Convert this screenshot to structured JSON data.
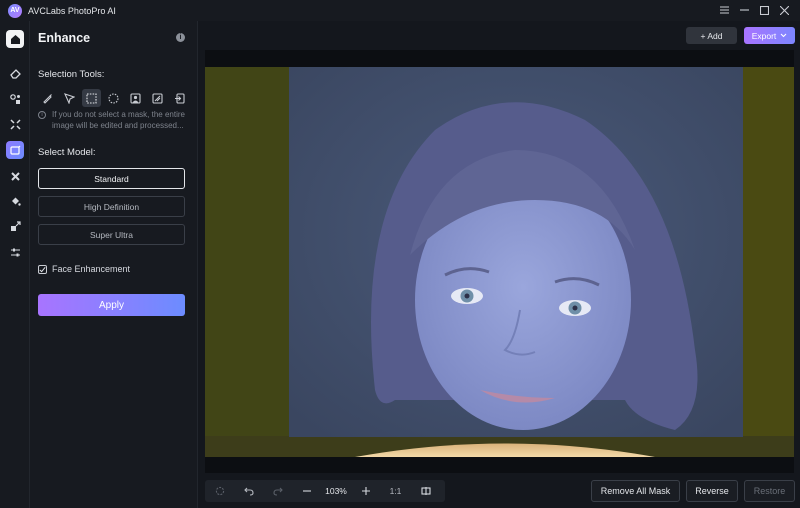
{
  "titlebar": {
    "logo_text": "AV",
    "title": "AVCLabs PhotoPro AI"
  },
  "panel": {
    "title": "Enhance",
    "selection_tools_label": "Selection Tools:",
    "hint_text": "If you do not select a mask, the entire image will be edited and processed...",
    "select_model_label": "Select Model:",
    "models": [
      {
        "label": "Standard",
        "selected": true
      },
      {
        "label": "High Definition",
        "selected": false
      },
      {
        "label": "Super Ultra",
        "selected": false
      }
    ],
    "face_enhancement_label": "Face Enhancement",
    "face_enhancement_checked": true,
    "apply_label": "Apply"
  },
  "header": {
    "add_label": "+ Add",
    "export_label": "Export"
  },
  "bottom_toolbar": {
    "zoom": "103%",
    "one_to_one": "1:1"
  },
  "actions": {
    "remove_all_mask": "Remove All Mask",
    "reverse": "Reverse",
    "restore": "Restore"
  },
  "colors": {
    "accent_start": "#a874ff",
    "accent_end": "#6c8cff",
    "background": "#14171d",
    "panel": "#171a20"
  }
}
